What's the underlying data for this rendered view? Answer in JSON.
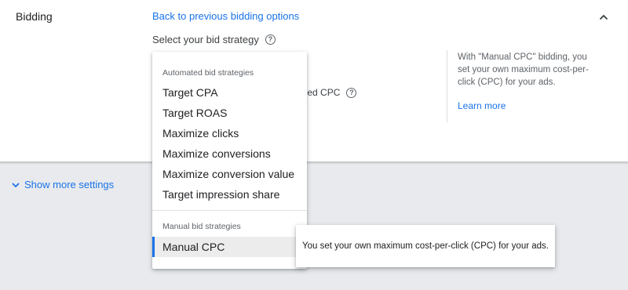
{
  "section": {
    "title": "Bidding"
  },
  "header": {
    "back_link": "Back to previous bidding options",
    "collapse_icon": "chevron-up-icon"
  },
  "strategy": {
    "label": "Select your bid strategy",
    "help_icon": "help-circle-icon",
    "enhanced_cpc_partial": "anced CPC"
  },
  "info": {
    "text": "With \"Manual CPC\" bidding, you set your own maximum cost-per-click (CPC) for your ads.",
    "learn_more": "Learn more"
  },
  "show_more": {
    "label": "Show more settings",
    "icon": "chevron-down-icon"
  },
  "dropdown": {
    "automated_header": "Automated bid strategies",
    "automated_items": [
      "Target CPA",
      "Target ROAS",
      "Maximize clicks",
      "Maximize conversions",
      "Maximize conversion value",
      "Target impression share"
    ],
    "manual_header": "Manual bid strategies",
    "manual_items": [
      "Manual CPC"
    ],
    "selected": "Manual CPC"
  },
  "tooltip": {
    "text": "You set your own maximum cost-per-click (CPC) for your ads."
  },
  "colors": {
    "link": "#1a73e8",
    "selected_bar": "#1a73e8",
    "text": "#202124",
    "muted": "#5f6368"
  }
}
